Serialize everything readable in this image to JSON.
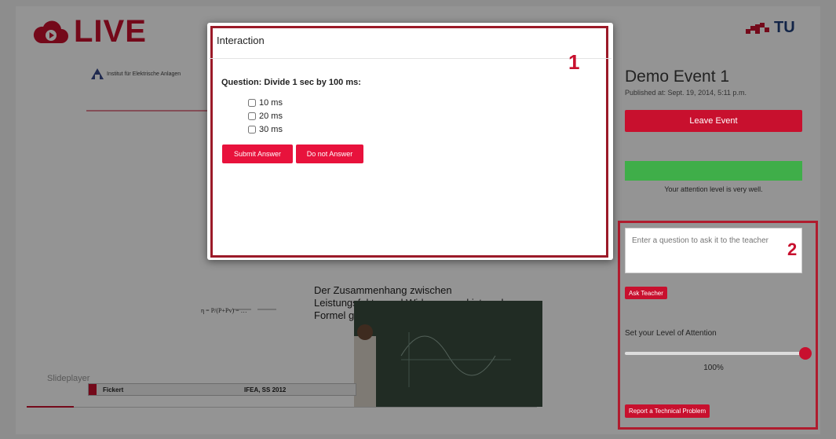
{
  "header": {
    "logo_text": "LIVE",
    "tu_logo_text": "TU"
  },
  "slide": {
    "institute": "Institut für Elektrische Anlagen",
    "body_text": "Der Zusammenhang zwischen Leistungsfaktor und Wirkungsgrad ist nach Formel gegeben angibt.",
    "footer_name": "Fickert",
    "footer_course": "IFEA, SS 2012",
    "player_label": "Slideplayer"
  },
  "sidebar": {
    "event_title": "Demo Event 1",
    "published": "Published at: Sept. 19, 2014, 5:11 p.m.",
    "leave_button": "Leave Event",
    "attention_level": 1.0,
    "attention_color": "#3fae49",
    "attention_text": "Your attention level is very well.",
    "question_placeholder": "Enter a question to ask it to the teacher",
    "ask_button": "Ask Teacher",
    "set_level_label": "Set your Level of Attention",
    "level_value": "100%",
    "report_button": "Report a Technical Problem",
    "annotation_number": "2"
  },
  "modal": {
    "title": "Interaction",
    "annotation_number": "1",
    "question": "Question: Divide 1 sec by 100 ms:",
    "options": [
      "10 ms",
      "20 ms",
      "30 ms"
    ],
    "submit_button": "Submit Answer",
    "skip_button": "Do not Answer"
  },
  "colors": {
    "brand": "#c8102e",
    "button_red": "#e8123c",
    "annotation_border": "#9b1a28"
  }
}
